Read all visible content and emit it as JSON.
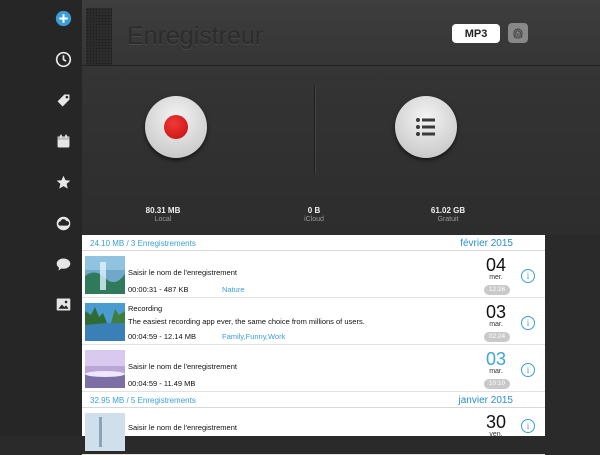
{
  "sidebar": {
    "items": [
      {
        "icon": "add-circle-icon"
      },
      {
        "icon": "clock-icon"
      },
      {
        "icon": "tag-icon"
      },
      {
        "icon": "calendar-icon"
      },
      {
        "icon": "star-icon"
      },
      {
        "icon": "cloud-icon"
      },
      {
        "icon": "chat-bubble-icon"
      },
      {
        "icon": "image-icon"
      }
    ]
  },
  "header": {
    "title": "Enregistreur",
    "format_label": "MP3"
  },
  "stats": {
    "local": {
      "value": "80.31 MB",
      "label": "Local"
    },
    "icloud": {
      "value": "0 B",
      "label": "iCloud"
    },
    "free": {
      "value": "61.02 GB",
      "label": "Gratuit"
    }
  },
  "sections": [
    {
      "summary": "24.10 MB / 3 Enregistrements",
      "month": "février 2015",
      "rows": [
        {
          "title": "Saisir le nom de l'enregistrement",
          "subtitle": "",
          "duration": "00:00:31",
          "size": "487 KB",
          "tags": "Nature",
          "day": "04",
          "dow": "mer.",
          "time": "12:26",
          "day_color": "#111111"
        },
        {
          "title": "Recording",
          "subtitle": "The easiest recording app ever, the same choice from millions of users.",
          "duration": "00:04:59",
          "size": "12.14 MB",
          "tags": "Family,Funny,Work",
          "day": "03",
          "dow": "mar.",
          "time": "02:24",
          "day_color": "#111111"
        },
        {
          "title": "Saisir le nom de l'enregistrement",
          "subtitle": "",
          "duration": "00:04:59",
          "size": "11.49 MB",
          "tags": "",
          "day": "03",
          "dow": "mar.",
          "time": "10:10",
          "day_color": "#39a6de"
        }
      ]
    },
    {
      "summary": "32.95 MB / 5 Enregistrements",
      "month": "janvier 2015",
      "rows": [
        {
          "title": "Saisir le nom de l'enregistrement",
          "subtitle": "",
          "duration": "",
          "size": "",
          "tags": "",
          "day": "30",
          "dow": "ven.",
          "time": "",
          "day_color": "#111111"
        }
      ]
    }
  ],
  "colors": {
    "accent": "#3a9fd8",
    "record": "#d11a1a",
    "sidebar_icon": "#e6e6e6"
  }
}
